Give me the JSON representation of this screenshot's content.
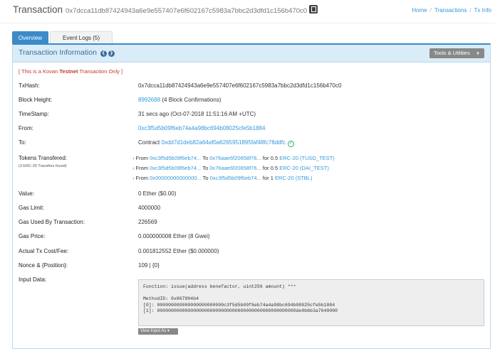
{
  "header": {
    "title": "Transaction",
    "hash": "0x7dcca11db87424943a6e9e557407e6f602167c5983a7bbc2d3dfd1c156b470c0",
    "breadcrumbs": [
      "Home",
      "Transactions",
      "Tx Info"
    ]
  },
  "tabs": [
    {
      "label": "Overview",
      "active": true
    },
    {
      "label": "Event Logs (5)",
      "active": false
    }
  ],
  "panel": {
    "title": "Transaction Information",
    "tools_label": "Tools & Utilities",
    "notice": {
      "pre": "[ This is a Kovan ",
      "bold": "Testnet",
      "post": " Transaction Only ]"
    }
  },
  "fields": {
    "txhash": {
      "label": "TxHash:",
      "value": "0x7dcca11db87424943a6e9e557407e6f602167c5983a7bbc2d3dfd1c156b470c0"
    },
    "block": {
      "label": "Block Height:",
      "value": "8992688",
      "extra": "(4 Block Confirmations)"
    },
    "timestamp": {
      "label": "TimeStamp:",
      "value": "31 secs ago (Oct-07-2018 11:51:16 AM +UTC)"
    },
    "from": {
      "label": "From:",
      "value": "0xc3f5d5b09f6eb74a4a98bc694b08025cfe5b1884"
    },
    "to": {
      "label": "To:",
      "prefix": "Contract",
      "value": "0xdd7d1deb82a64af0a6265951895faf48fc78ddfc"
    },
    "tokens": {
      "label": "Tokens Transfered:",
      "sublabel": "(3 ERC-20 Transfers found)",
      "items": [
        {
          "from": "0xc3f5d5b09f6eb74...",
          "to": "0x76aae6f20658f76...",
          "amount": "0.5",
          "token": "ERC-20 (TUSD_TEST)"
        },
        {
          "from": "0xc3f5d5b09f6eb74...",
          "to": "0x76aae6f20658f76...",
          "amount": "0.5",
          "token": "ERC-20 (DAI_TEST)"
        },
        {
          "from": "0x00000000000000...",
          "to": "0xc3f5d5b09f6eb74...",
          "amount": "1",
          "token": "ERC-20 (STBL)"
        }
      ]
    },
    "value": {
      "label": "Value:",
      "value": "0 Ether ($0.00)"
    },
    "gas_limit": {
      "label": "Gas Limit:",
      "value": "4000000"
    },
    "gas_used": {
      "label": "Gas Used By Transaction:",
      "value": "226569"
    },
    "gas_price": {
      "label": "Gas Price:",
      "value": "0.000000008 Ether (8 Gwei)"
    },
    "cost": {
      "label": "Actual Tx Cost/Fee:",
      "value": "0.001812552 Ether ($0.000000)"
    },
    "nonce": {
      "label": "Nonce & {Position}:",
      "value": "109 | {0}"
    },
    "input": {
      "label": "Input Data:",
      "lines": [
        "Function: issue(address benefactor, uint256 amount) ***",
        "",
        "MethodID: 0x867904b4",
        "[0]:  000000000000000000000000c3f5d5b09f6eb74a4a98bc694b08025cfe5b1884",
        "[1]:  00000000000000000000000000000000000000000000000000de0b6b3a7640000"
      ],
      "view_label": "View Input As"
    }
  }
}
